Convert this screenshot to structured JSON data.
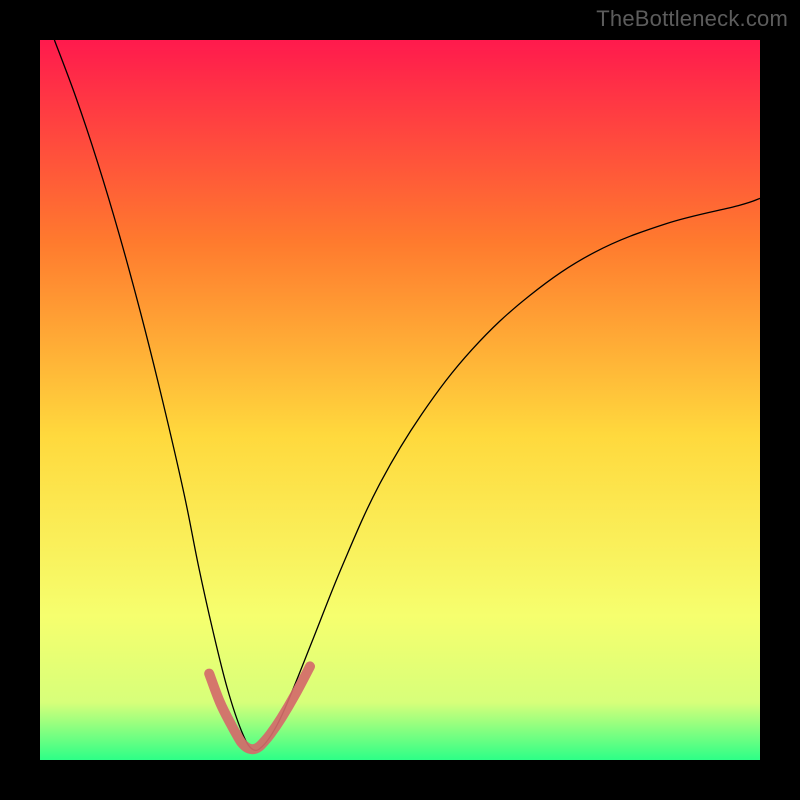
{
  "watermark": "TheBottleneck.com",
  "chart_data": {
    "type": "line",
    "title": "",
    "xlabel": "",
    "ylabel": "",
    "xlim": [
      0,
      100
    ],
    "ylim": [
      0,
      100
    ],
    "background_gradient": {
      "top": "#ff1a4d",
      "upper_mid": "#ff7a2e",
      "mid": "#ffd93d",
      "lower_mid": "#f6ff6e",
      "bottom": "#2dff87"
    },
    "series": [
      {
        "name": "main-curve",
        "color": "#000000",
        "stroke_width": 1.3,
        "x": [
          2,
          5,
          8,
          11,
          14,
          17,
          20,
          22,
          24,
          26,
          28,
          29.5,
          31,
          33,
          35,
          38,
          42,
          47,
          53,
          60,
          68,
          77,
          87,
          97,
          100
        ],
        "y": [
          100,
          92,
          83,
          73,
          62,
          50,
          37,
          27,
          18,
          10,
          4,
          1.5,
          2,
          5,
          9.5,
          17,
          27,
          38,
          48,
          57,
          64.5,
          70.5,
          74.5,
          77,
          78
        ]
      },
      {
        "name": "bottom-marker-band",
        "color": "#d46a6a",
        "stroke_width": 10,
        "x": [
          23.5,
          25,
          26.5,
          27.5,
          28,
          28.5,
          29,
          29.5,
          30,
          30.5,
          31,
          32,
          33.5,
          35.5,
          37.5
        ],
        "y": [
          12,
          8,
          5,
          3.2,
          2.4,
          1.9,
          1.6,
          1.5,
          1.6,
          1.9,
          2.4,
          3.6,
          5.8,
          9.2,
          13
        ]
      }
    ],
    "annotations": []
  }
}
